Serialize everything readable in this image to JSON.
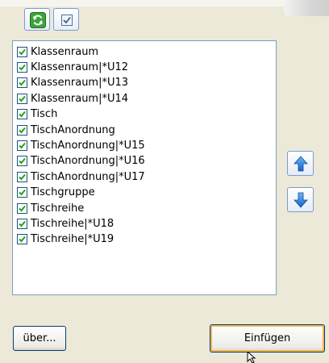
{
  "toolbar": {
    "refresh_icon": "refresh-icon",
    "check_all_icon": "check-all-icon"
  },
  "items": [
    {
      "label": "Klassenraum",
      "checked": true
    },
    {
      "label": "Klassenraum|*U12",
      "checked": true
    },
    {
      "label": "Klassenraum|*U13",
      "checked": true
    },
    {
      "label": "Klassenraum|*U14",
      "checked": true
    },
    {
      "label": "Tisch",
      "checked": true
    },
    {
      "label": "TischAnordnung",
      "checked": true
    },
    {
      "label": "TischAnordnung|*U15",
      "checked": true
    },
    {
      "label": "TischAnordnung|*U16",
      "checked": true
    },
    {
      "label": "TischAnordnung|*U17",
      "checked": true
    },
    {
      "label": "Tischgruppe",
      "checked": true
    },
    {
      "label": "Tischreihe",
      "checked": true
    },
    {
      "label": "Tischreihe|*U18",
      "checked": true
    },
    {
      "label": "Tischreihe|*U19",
      "checked": true
    }
  ],
  "buttons": {
    "about_label": "über...",
    "insert_label": "Einfügen"
  },
  "colors": {
    "accent": "#2a7ad5",
    "check": "#21a121",
    "refresh": "#2e9a2e"
  }
}
